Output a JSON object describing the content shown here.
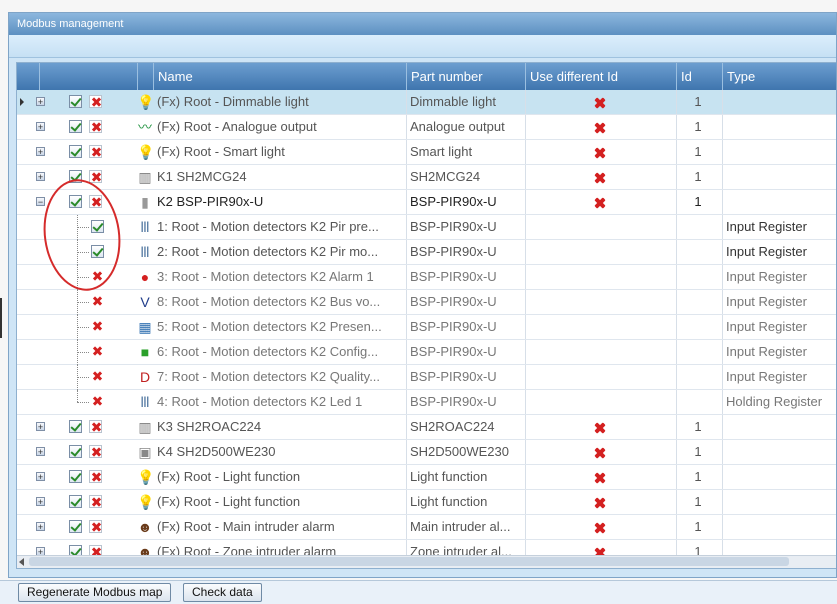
{
  "window": {
    "title": "Modbus management"
  },
  "columns": {
    "name": "Name",
    "part": "Part number",
    "diff": "Use different Id",
    "id": "Id",
    "type": "Type"
  },
  "rows": [
    {
      "name": "(Fx) Root - Dimmable light",
      "part": "Dimmable light",
      "id": "1",
      "type": "",
      "icon": "bulb-icon",
      "level": 0,
      "selected": true
    },
    {
      "name": "(Fx) Root - Analogue output",
      "part": "Analogue output",
      "id": "1",
      "type": "",
      "icon": "analogue-wave-icon",
      "level": 0
    },
    {
      "name": "(Fx) Root - Smart light",
      "part": "Smart light",
      "id": "1",
      "type": "",
      "icon": "bulb-icon",
      "level": 0
    },
    {
      "name": "K1 SH2MCG24",
      "part": "SH2MCG24",
      "id": "1",
      "type": "",
      "icon": "module-icon",
      "level": 0
    },
    {
      "name": "K2 BSP-PIR90x-U",
      "part": "BSP-PIR90x-U",
      "id": "1",
      "type": "",
      "icon": "sensor-icon",
      "level": 0,
      "expanded": true,
      "dark": true
    },
    {
      "name": "1: Root - Motion detectors K2 Pir pre...",
      "part": "BSP-PIR90x-U",
      "type": "Input Register",
      "icon": "register-icon",
      "level": 1,
      "checked": true
    },
    {
      "name": "2: Root - Motion detectors K2 Pir mo...",
      "part": "BSP-PIR90x-U",
      "type": "Input Register",
      "icon": "register-icon",
      "level": 1,
      "checked": true
    },
    {
      "name": "3: Root - Motion detectors K2 Alarm 1",
      "part": "BSP-PIR90x-U",
      "type": "Input Register",
      "icon": "alarm-icon",
      "level": 1
    },
    {
      "name": "8: Root - Motion detectors K2 Bus vo...",
      "part": "BSP-PIR90x-U",
      "type": "Input Register",
      "icon": "voltage-icon",
      "level": 1
    },
    {
      "name": "5: Root - Motion detectors K2 Presen...",
      "part": "BSP-PIR90x-U",
      "type": "Input Register",
      "icon": "presence-icon",
      "level": 1
    },
    {
      "name": "6: Root - Motion detectors K2 Config...",
      "part": "BSP-PIR90x-U",
      "type": "Input Register",
      "icon": "config-icon",
      "level": 1
    },
    {
      "name": "7: Root - Motion detectors K2 Quality...",
      "part": "BSP-PIR90x-U",
      "type": "Input Register",
      "icon": "dup-icon",
      "level": 1
    },
    {
      "name": "4: Root - Motion detectors K2 Led 1",
      "part": "BSP-PIR90x-U",
      "type": "Holding Register",
      "icon": "register-icon",
      "level": 1
    },
    {
      "name": "K3 SH2ROAC224",
      "part": "SH2ROAC224",
      "id": "1",
      "type": "",
      "icon": "module-icon",
      "level": 0
    },
    {
      "name": "K4 SH2D500WE230",
      "part": "SH2D500WE230",
      "id": "1",
      "type": "",
      "icon": "dimmer-icon",
      "level": 0
    },
    {
      "name": "(Fx) Root - Light function",
      "part": "Light function",
      "id": "1",
      "type": "",
      "icon": "bulb-icon",
      "level": 0
    },
    {
      "name": "(Fx) Root - Light function",
      "part": "Light function",
      "id": "1",
      "type": "",
      "icon": "bulb-icon",
      "level": 0
    },
    {
      "name": "(Fx) Root - Main intruder alarm",
      "part": "Main intruder al...",
      "id": "1",
      "type": "",
      "icon": "intruder-icon",
      "level": 0
    },
    {
      "name": "(Fx) Root - Zone intruder alarm",
      "part": "Zone intruder al...",
      "id": "1",
      "type": "",
      "icon": "intruder-icon",
      "level": 0
    }
  ],
  "buttons": {
    "regenerate": "Regenerate Modbus map",
    "check": "Check data"
  },
  "colors": {
    "header": "#4a80b8",
    "selected_row": "#c7e3f1",
    "annotation_circle": "#d52b2b"
  }
}
